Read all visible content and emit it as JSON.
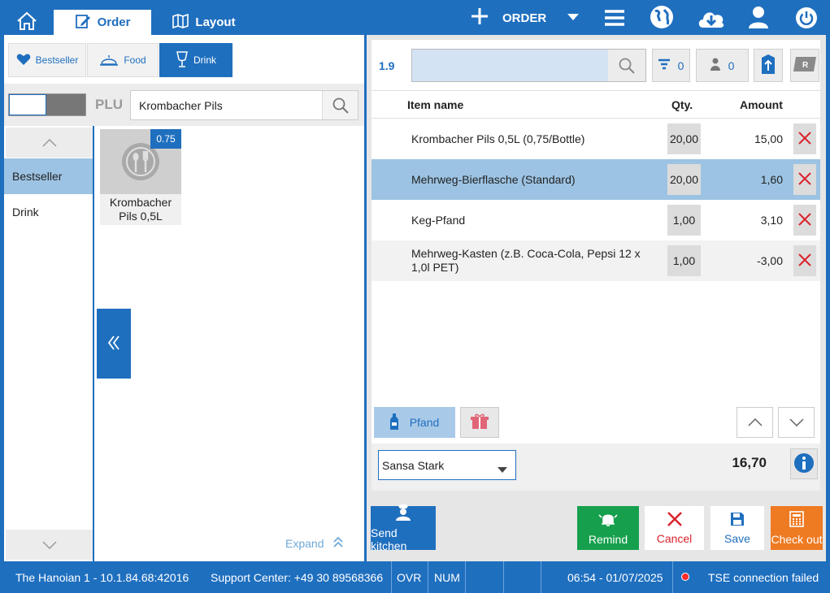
{
  "nav": {
    "tabs": [
      {
        "label": "Order",
        "icon": "edit-order-icon"
      },
      {
        "label": "Layout",
        "icon": "map-icon"
      }
    ],
    "order_label": "ORDER"
  },
  "categories": [
    {
      "label": "Bestseller",
      "icon": "heart-icon"
    },
    {
      "label": "Food",
      "icon": "cloche-icon"
    },
    {
      "label": "Drink",
      "icon": "glass-icon"
    }
  ],
  "plu": {
    "label": "PLU",
    "search_value": "Krombacher Pils"
  },
  "sidebar": {
    "items": [
      {
        "label": "Bestseller"
      },
      {
        "label": "Drink"
      }
    ]
  },
  "products": [
    {
      "name": "Krombacher Pils 0,5L",
      "badge": "0.75"
    }
  ],
  "expand_label": "Expand",
  "order": {
    "table_number": "1.9",
    "filter_count": "0",
    "guest_count": "0",
    "columns": {
      "name": "Item name",
      "qty": "Qty.",
      "amount": "Amount"
    },
    "items": [
      {
        "name": "Krombacher Pils 0,5L (0,75/Bottle)",
        "qty": "20,00",
        "amount": "15,00"
      },
      {
        "name": "Mehrweg-Bierflasche (Standard)",
        "qty": "20,00",
        "amount": "1,60",
        "selected": true
      },
      {
        "name": "Keg-Pfand",
        "qty": "1,00",
        "amount": "3,10"
      },
      {
        "name": "Mehrweg-Kasten (z.B. Coca-Cola, Pepsi 12 x 1,0l PET)",
        "qty": "1,00",
        "amount": "-3,00"
      }
    ],
    "pfand_label": "Pfand",
    "customer": "Sansa Stark",
    "total": "16,70"
  },
  "actions": [
    {
      "label": "Send kitchen",
      "icon": "chef-icon",
      "color": "#1f6fbf"
    },
    {
      "label": "Remind",
      "icon": "bell-icon",
      "color": "#16a04d"
    },
    {
      "label": "Cancel",
      "icon": "close-icon",
      "color": "#d9232d"
    },
    {
      "label": "Save",
      "icon": "save-icon",
      "color": "#1f6fbf"
    },
    {
      "label": "Check out",
      "icon": "calculator-icon",
      "color": "#ee7a22"
    }
  ],
  "status": {
    "location": "The Hanoian 1 - 10.1.84.68:42016",
    "support": "Support Center: +49 30 89568366",
    "ovr": "OVR",
    "num": "NUM",
    "datetime": "06:54 - 01/07/2025",
    "tse": "TSE connection failed"
  },
  "colors": {
    "primary": "#1f6fbf",
    "selected_row": "#9cc3e3",
    "delete": "#d9232d"
  }
}
